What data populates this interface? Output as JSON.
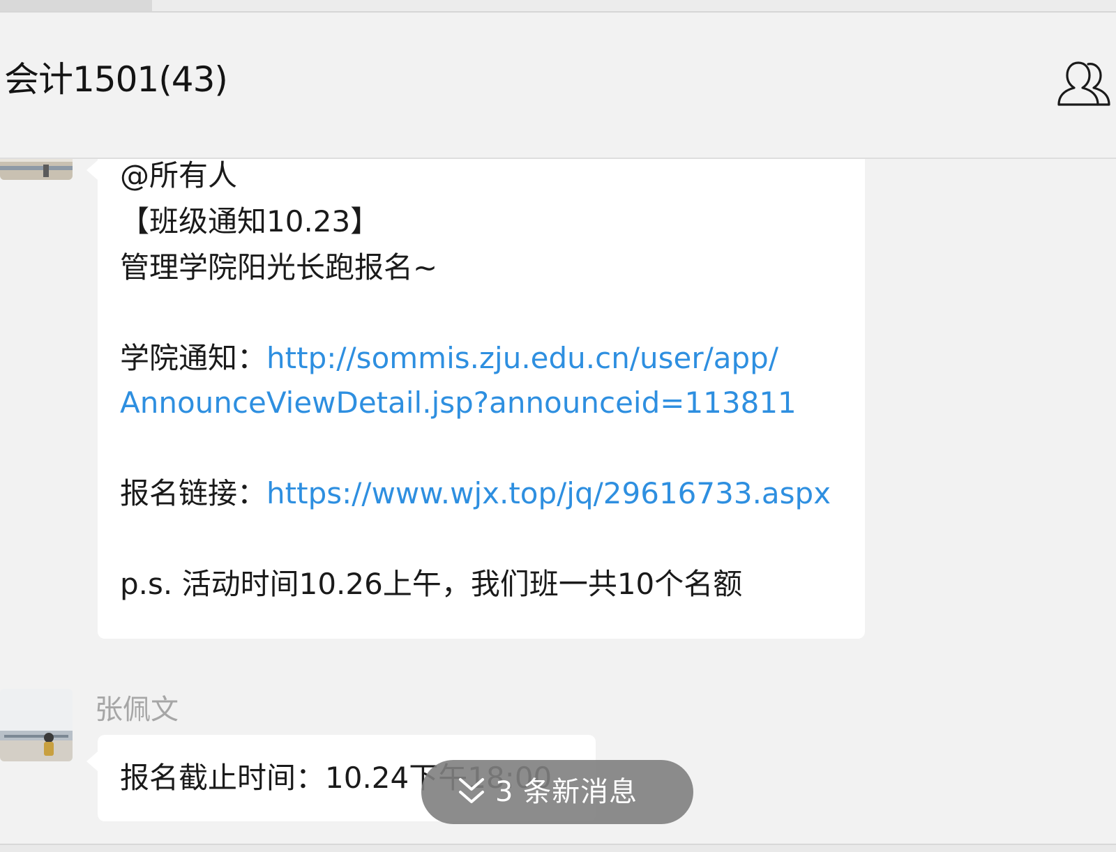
{
  "header": {
    "title": "会计1501(43)",
    "members_icon": "group-members-icon"
  },
  "messages": [
    {
      "sender": "",
      "lines": [
        {
          "text": "@所有人"
        },
        {
          "text": "【班级通知10.23】"
        },
        {
          "text": "管理学院阳光长跑报名~"
        },
        {
          "prefix": "学院通知：",
          "link": "http://sommis.zju.edu.cn/user/app/"
        },
        {
          "link": "AnnounceViewDetail.jsp?announceid=113811"
        },
        {
          "prefix": "报名链接：",
          "link": "https://www.wjx.top/jq/29616733.aspx"
        },
        {
          "text": "p.s. 活动时间10.26上午，我们班一共10个名额"
        }
      ]
    },
    {
      "sender": "张佩文",
      "lines": [
        {
          "text": "报名截止时间：10.24下午18:00"
        }
      ]
    }
  ],
  "new_messages_pill": {
    "label": "3 条新消息",
    "icon": "double-chevron-down-icon"
  },
  "colors": {
    "background": "#f2f2f2",
    "bubble": "#ffffff",
    "link": "#2e8fe0",
    "sender": "#a6a6a6",
    "pill": "#808080"
  }
}
